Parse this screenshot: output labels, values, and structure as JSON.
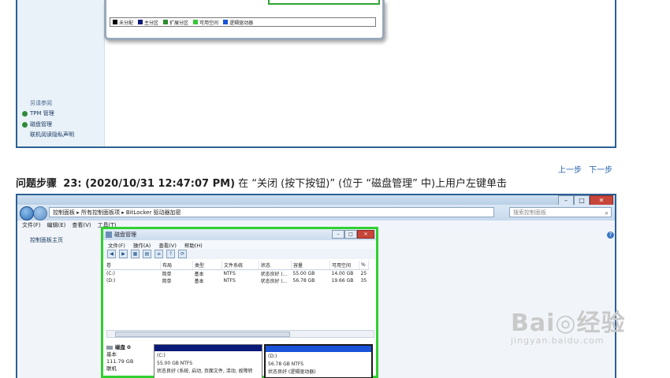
{
  "top_screenshot": {
    "legend": [
      {
        "label": "未分配",
        "color": "#000000"
      },
      {
        "label": "主分区",
        "color": "#0a1a78"
      },
      {
        "label": "扩展分区",
        "color": "#2e8b2e"
      },
      {
        "label": "可用空间",
        "color": "#37c837"
      },
      {
        "label": "逻辑驱动器",
        "color": "#1a52d8"
      }
    ],
    "see_also_title": "另请参阅",
    "see_also": [
      "TPM 管理",
      "磁盘管理",
      "联机阅读隐私声明"
    ]
  },
  "step_nav": {
    "prev": "上一步",
    "next": "下一步"
  },
  "step": {
    "title": "问题步骤",
    "meta": "23: (2020/10/31 12:47:07 PM)",
    "description": "在 “关闭 (按下按钮)” (位于 “磁盘管理” 中)上用户左键单击"
  },
  "bottom_screenshot": {
    "address": "控制面板 ▸ 所有控制面板项 ▸ BitLocker 驱动器加密",
    "search_placeholder": "搜索控制面板",
    "menu": [
      "文件(F)",
      "编辑(E)",
      "查看(V)",
      "工具(T)"
    ],
    "left_link": "控制面板主页",
    "disk_mgmt": {
      "title": "磁盘管理",
      "menu": [
        "文件(F)",
        "操作(A)",
        "查看(V)",
        "帮助(H)"
      ],
      "columns": [
        "卷",
        "布局",
        "类型",
        "文件系统",
        "状态",
        "容量",
        "可用空间",
        "%"
      ],
      "rows": [
        [
          "(C:)",
          "简单",
          "基本",
          "NTFS",
          "状态良好 (...",
          "55.00 GB",
          "14.00 GB",
          "25"
        ],
        [
          "(D:)",
          "简单",
          "基本",
          "NTFS",
          "状态良好 (...",
          "56.78 GB",
          "19.66 GB",
          "35"
        ]
      ],
      "disk": {
        "name": "磁盘 0",
        "type": "基本",
        "size": "111.79 GB",
        "status": "联机"
      },
      "partitions": [
        {
          "label": "(C:)",
          "size": "55.00 GB NTFS",
          "status": "状态良好 (系统, 启动, 页面文件, 活动, 故障转"
        },
        {
          "label": "(D:)",
          "size": "56.78 GB NTFS",
          "status": "状态良好 (逻辑驱动器)"
        }
      ]
    }
  },
  "watermark": {
    "text": "Bai◎经验",
    "url": "jingyan.baidu.com"
  }
}
